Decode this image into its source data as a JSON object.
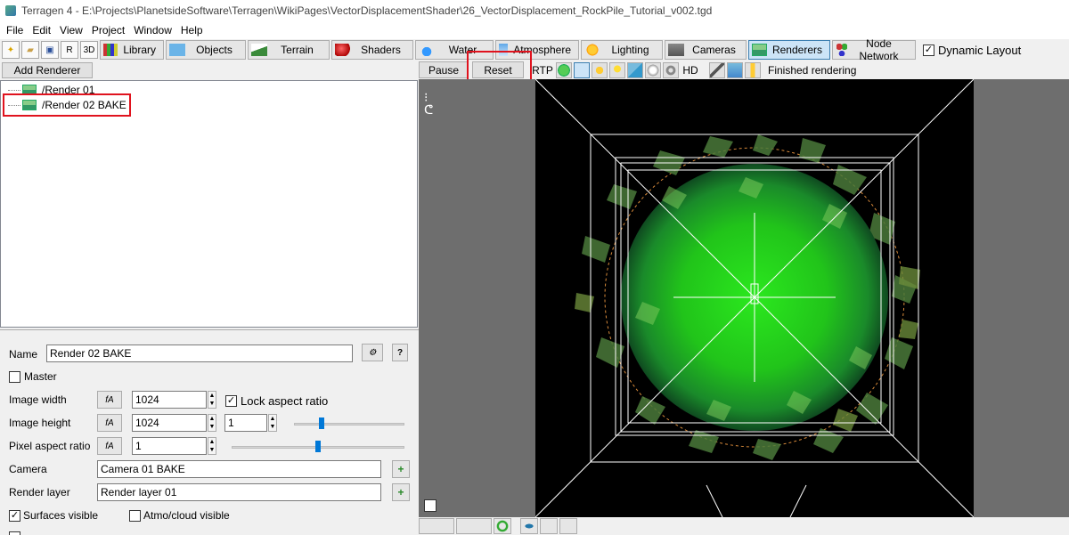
{
  "window": {
    "title": "Terragen 4 - E:\\Projects\\PlanetsideSoftware\\Terragen\\WikiPages\\VectorDisplacementShader\\26_VectorDisplacement_RockPile_Tutorial_v002.tgd"
  },
  "menu": {
    "file": "File",
    "edit": "Edit",
    "view": "View",
    "project": "Project",
    "window": "Window",
    "help": "Help"
  },
  "toolbar": {
    "library": "Library",
    "objects": "Objects",
    "terrain": "Terrain",
    "shaders": "Shaders",
    "water": "Water",
    "atmosphere": "Atmosphere",
    "lighting": "Lighting",
    "cameras": "Cameras",
    "renderers": "Renderers",
    "node_network": "Node Network",
    "dynamic_layout": "Dynamic Layout",
    "icon_3d": "3D",
    "icon_r": "R"
  },
  "render_toolbar": {
    "pause": "Pause",
    "reset": "Reset",
    "rtp": "RTP",
    "hd": "HD",
    "status": "Finished rendering"
  },
  "left": {
    "add_renderer": "Add Renderer",
    "tree": [
      {
        "label": "/Render 01"
      },
      {
        "label": "/Render 02 BAKE"
      }
    ]
  },
  "props": {
    "name_label": "Name",
    "name_value": "Render 02 BAKE",
    "help": "?",
    "master_label": "Master",
    "image_width_label": "Image width",
    "image_width_value": "1024",
    "lock_aspect_label": "Lock aspect ratio",
    "image_height_label": "Image height",
    "image_height_value": "1024",
    "aspect_value": "1",
    "pixel_aspect_label": "Pixel aspect ratio",
    "pixel_aspect_value": "1",
    "camera_label": "Camera",
    "camera_value": "Camera 01 BAKE",
    "render_layer_label": "Render layer",
    "render_layer_value": "Render layer 01",
    "surfaces_visible_label": "Surfaces visible",
    "atmo_visible_label": "Atmo/cloud visible",
    "fn_icon": "fA",
    "plus": "+"
  },
  "colors": {
    "highlight": "#e0131e",
    "accent": "#0078d7",
    "render_green": "#2be81e"
  }
}
